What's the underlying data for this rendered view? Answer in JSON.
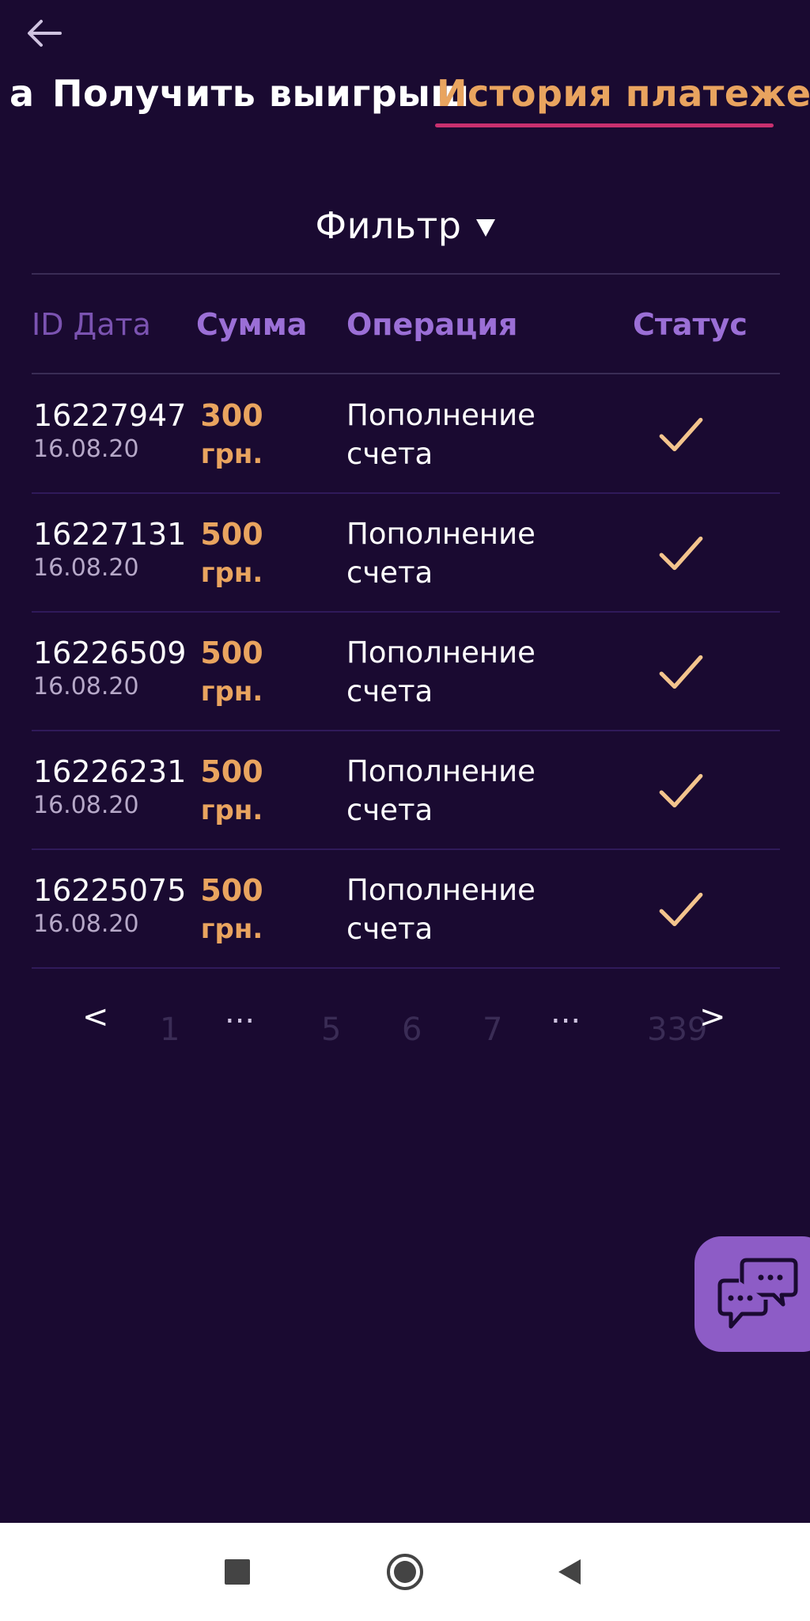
{
  "header": {
    "back_icon": "arrow-left-icon"
  },
  "tabs": {
    "partial_label": "а",
    "withdraw_label": "Получить выигрыш",
    "history_label": "История платежей",
    "active_color": "#e9a45f",
    "underline_color": "#c9306f"
  },
  "filter": {
    "label": "Фильтр",
    "icon": "triangle-down-icon"
  },
  "table": {
    "headers": {
      "id_date": "ID Дата",
      "amount": "Сумма",
      "operation": "Операция",
      "status": "Статус"
    },
    "rows": [
      {
        "id": "16227947",
        "date": "16.08.20",
        "amount": "300",
        "currency": "грн.",
        "operation_line1": "Пополнение",
        "operation_line2": "счета",
        "status_icon": "checkmark-icon"
      },
      {
        "id": "16227131",
        "date": "16.08.20",
        "amount": "500",
        "currency": "грн.",
        "operation_line1": "Пополнение",
        "operation_line2": "счета",
        "status_icon": "checkmark-icon"
      },
      {
        "id": "16226509",
        "date": "16.08.20",
        "amount": "500",
        "currency": "грн.",
        "operation_line1": "Пополнение",
        "operation_line2": "счета",
        "status_icon": "checkmark-icon"
      },
      {
        "id": "16226231",
        "date": "16.08.20",
        "amount": "500",
        "currency": "грн.",
        "operation_line1": "Пополнение",
        "operation_line2": "счета",
        "status_icon": "checkmark-icon"
      },
      {
        "id": "16225075",
        "date": "16.08.20",
        "amount": "500",
        "currency": "грн.",
        "operation_line1": "Пополнение",
        "operation_line2": "счета",
        "status_icon": "checkmark-icon"
      }
    ]
  },
  "pagination": {
    "prev": "<",
    "next": ">",
    "first": "1",
    "dots_left": "...",
    "page_5": "5",
    "page_6": "6",
    "page_7": "7",
    "dots_right": "...",
    "last": "339"
  },
  "chat": {
    "icon": "chat-bubbles-icon",
    "color": "#8d5cc6"
  },
  "system_nav": {
    "recents_icon": "square-icon",
    "home_icon": "circle-icon",
    "back_icon": "triangle-back-icon"
  },
  "colors": {
    "background": "#1a0a31",
    "accent": "#e9a45f",
    "header_purple": "#9b6fd6"
  }
}
